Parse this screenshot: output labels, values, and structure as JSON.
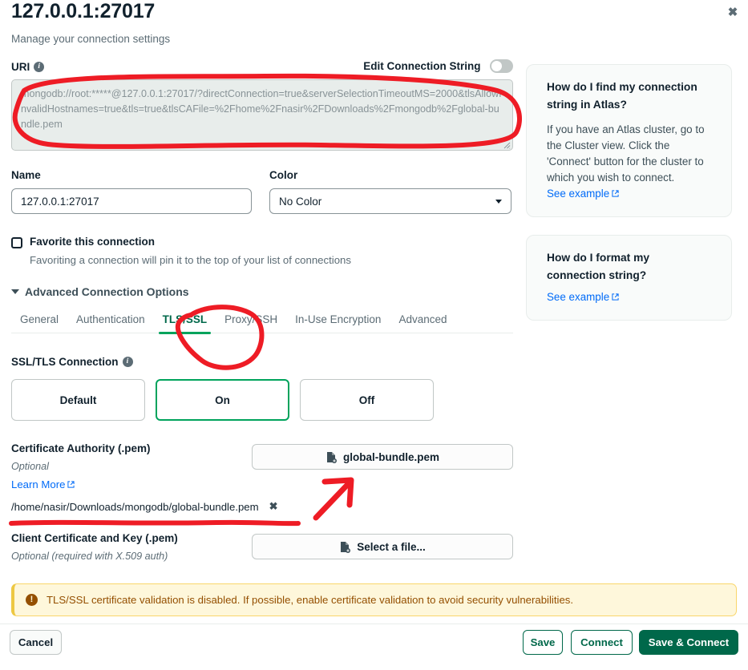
{
  "window": {
    "title": "127.0.0.1:27017",
    "subtitle": "Manage your connection settings",
    "close_label": "✖"
  },
  "uri": {
    "label": "URI",
    "info_glyph": "i",
    "edit_toggle_label": "Edit Connection String",
    "toggle_state": "off",
    "value": "mongodb://root:*****@127.0.0.1:27017/?directConnection=true&serverSelectionTimeoutMS=2000&tlsAllowInvalidHostnames=true&tls=true&tlsCAFile=%2Fhome%2Fnasir%2FDownloads%2Fmongodb%2Fglobal-bundle.pem"
  },
  "name_field": {
    "label": "Name",
    "value": "127.0.0.1:27017"
  },
  "color_field": {
    "label": "Color",
    "selected": "No Color"
  },
  "favorite": {
    "label": "Favorite this connection",
    "help": "Favoriting a connection will pin it to the top of your list of connections",
    "checked": false
  },
  "advanced": {
    "label": "Advanced Connection Options",
    "expanded": true
  },
  "tabs": [
    {
      "label": "General",
      "active": false
    },
    {
      "label": "Authentication",
      "active": false
    },
    {
      "label": "TLS/SSL",
      "active": true
    },
    {
      "label": "Proxy/SSH",
      "active": false
    },
    {
      "label": "In-Use Encryption",
      "active": false
    },
    {
      "label": "Advanced",
      "active": false
    }
  ],
  "ssl": {
    "label": "SSL/TLS Connection",
    "info_glyph": "i",
    "options": [
      {
        "label": "Default",
        "selected": false
      },
      {
        "label": "On",
        "selected": true
      },
      {
        "label": "Off",
        "selected": false
      }
    ]
  },
  "certificate_authority": {
    "label": "Certificate Authority (.pem)",
    "optional_text": "Optional",
    "learn_more": "Learn More",
    "external_glyph": "↗",
    "file_button_label": "global-bundle.pem",
    "file_icon": "file-upload-icon",
    "selected_path": "/home/nasir/Downloads/mongodb/global-bundle.pem",
    "remove_glyph": "✖"
  },
  "client_certificate": {
    "label": "Client Certificate and Key (.pem)",
    "optional_text": "Optional (required with X.509 auth)",
    "file_button_label": "Select a file...",
    "file_icon": "file-upload-icon"
  },
  "warning": {
    "icon_glyph": "!",
    "text": "TLS/SSL certificate validation is disabled. If possible, enable certificate validation to avoid security vulnerabilities."
  },
  "footer": {
    "cancel": "Cancel",
    "save": "Save",
    "connect": "Connect",
    "save_and_connect": "Save & Connect"
  },
  "sidebar": {
    "cards": [
      {
        "heading": "How do I find my connection string in Atlas?",
        "body": "If you have an Atlas cluster, go to the Cluster view. Click the 'Connect' button for the cluster to which you wish to connect.",
        "link": "See example"
      },
      {
        "heading": "How do I format my connection string?",
        "body": "",
        "link": "See example"
      }
    ]
  },
  "colors": {
    "brand_green": "#00684a",
    "accent_green": "#00a35c",
    "link_blue": "#016bf8",
    "warning_bg": "#fef7db",
    "warning_text": "#944f01",
    "annotation_red": "#ee1c25",
    "text_dark": "#11212d",
    "text_muted": "#5c6c75"
  },
  "annotations": {
    "uri_circle": "hand-drawn red oval around the URI connection string textarea",
    "tab_circle": "hand-drawn red oval around the TLS/SSL tab",
    "arrow": "hand-drawn red arrow pointing up-right toward the global-bundle.pem file button",
    "underline": "hand-drawn red underline beneath the selected certificate authority path"
  }
}
